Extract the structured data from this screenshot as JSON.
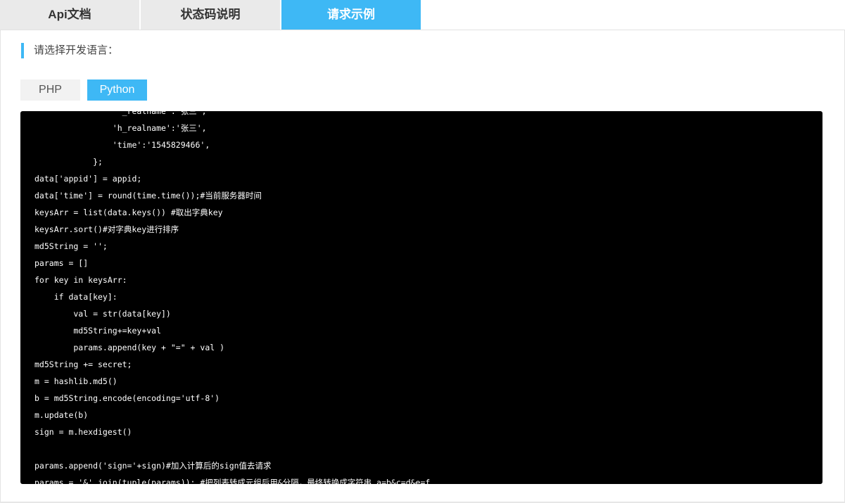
{
  "tabs": [
    {
      "label": "Api文档"
    },
    {
      "label": "状态码说明"
    },
    {
      "label": "请求示例"
    }
  ],
  "lang_prompt": "请选择开发语言：",
  "languages": [
    {
      "label": "PHP"
    },
    {
      "label": "Python"
    }
  ],
  "code_lines": [
    "                ''_realname':'张三',",
    "                'h_realname':'张三',",
    "                'time':'1545829466',",
    "            };",
    "data['appid'] = appid;",
    "data['time'] = round(time.time());#当前服务器时间",
    "keysArr = list(data.keys()) #取出字典key",
    "keysArr.sort()#对字典key进行排序",
    "md5String = '';",
    "params = []",
    "for key in keysArr:",
    "    if data[key]:",
    "        val = str(data[key])",
    "        md5String+=key+val",
    "        params.append(key + \"=\" + val )",
    "md5String += secret;",
    "m = hashlib.md5()",
    "b = md5String.encode(encoding='utf-8')",
    "m.update(b)",
    "sign = m.hexdigest()",
    "",
    "params.append('sign='+sign)#加入计算后的sign值去请求",
    "params = '&'.join(tuple(params)); #把列表转成元组后用&分隔，最终转换成字符串 a=b&c=d&e=f"
  ]
}
